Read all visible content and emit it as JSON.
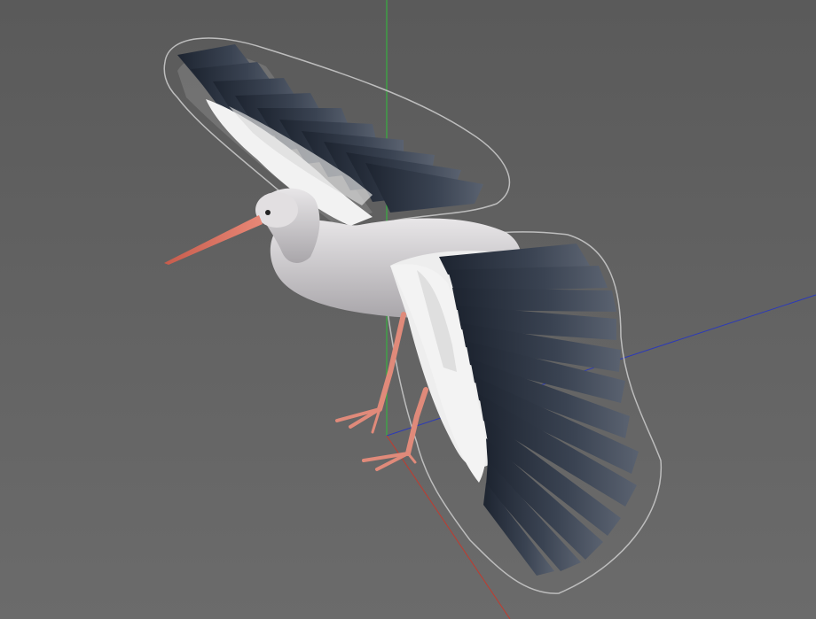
{
  "viewport": {
    "background_top": "#595959",
    "background_bottom": "#6a6a6a"
  },
  "axes": {
    "x_axis_color": "#c0392b",
    "y_axis_color": "#27ae60",
    "z_axis_color": "#2233aa"
  },
  "model": {
    "body_color": "#d9d6d8",
    "beak_color": "#e07a68",
    "leg_color": "#e08a7a",
    "primary_feather_color": "#2a3140",
    "covert_feather_color": "#eeeeee",
    "selection_outline_color": "#c8c8c8"
  }
}
